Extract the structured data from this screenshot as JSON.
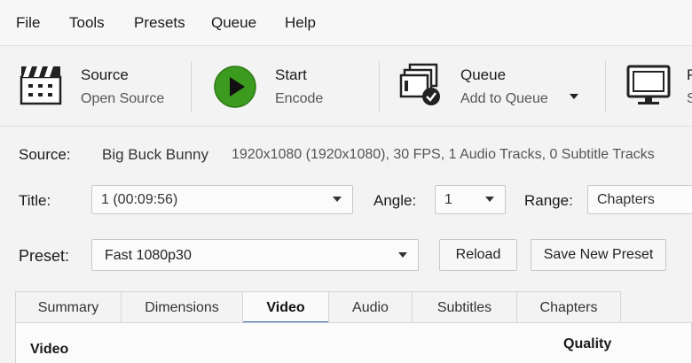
{
  "menu": [
    "File",
    "Tools",
    "Presets",
    "Queue",
    "Help"
  ],
  "toolbar": {
    "source": {
      "title": "Source",
      "sub": "Open Source"
    },
    "start": {
      "title": "Start",
      "sub": "Encode"
    },
    "queue": {
      "title": "Queue",
      "sub": "Add to Queue"
    },
    "preview": {
      "title": "P",
      "sub": "S"
    }
  },
  "source": {
    "label": "Source:",
    "name": "Big Buck Bunny",
    "info": "1920x1080 (1920x1080), 30 FPS, 1 Audio Tracks, 0 Subtitle Tracks"
  },
  "title_row": {
    "title_label": "Title:",
    "title_value": "1 (00:09:56)",
    "angle_label": "Angle:",
    "angle_value": "1",
    "range_label": "Range:",
    "range_value": "Chapters"
  },
  "preset": {
    "label": "Preset:",
    "value": "Fast 1080p30",
    "reload": "Reload",
    "save_new": "Save New Preset"
  },
  "tabs": [
    "Summary",
    "Dimensions",
    "Video",
    "Audio",
    "Subtitles",
    "Chapters"
  ],
  "active_tab": "Video",
  "panel": {
    "video_header": "Video",
    "quality_header": "Quality"
  },
  "colors": {
    "start_green": "#3c9a1f",
    "accent": "#2b6cb0"
  }
}
